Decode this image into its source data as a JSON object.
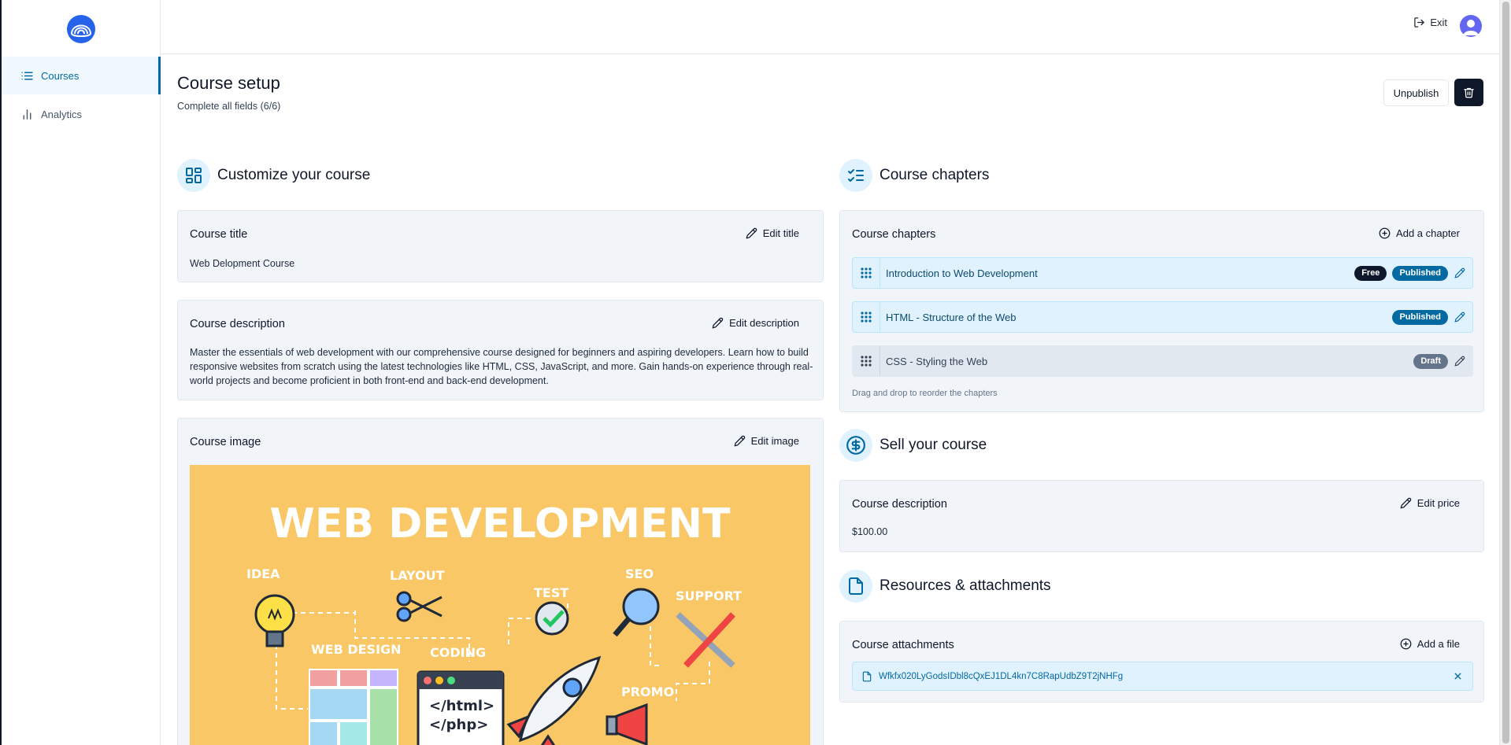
{
  "sidebar": {
    "items": [
      {
        "label": "Courses",
        "icon": "list-icon",
        "active": true
      },
      {
        "label": "Analytics",
        "icon": "bar-chart-icon",
        "active": false
      }
    ]
  },
  "topbar": {
    "exit_label": "Exit"
  },
  "header": {
    "title": "Course setup",
    "subtitle": "Complete all fields (6/6)",
    "unpublish_label": "Unpublish"
  },
  "customize": {
    "heading": "Customize your course",
    "title_card": {
      "label": "Course title",
      "action": "Edit title",
      "value": "Web Delopment Course"
    },
    "description_card": {
      "label": "Course description",
      "action": "Edit description",
      "value": "Master the essentials of web development with our comprehensive course designed for beginners and aspiring developers. Learn how to build responsive websites from scratch using the latest technologies like HTML, CSS, JavaScript, and more. Gain hands-on experience through real-world projects and become proficient in both front-end and back-end development."
    },
    "image_card": {
      "label": "Course image",
      "action": "Edit image",
      "image_text": {
        "headline": "WEB DEVELOPMENT",
        "idea": "IDEA",
        "layout": "LAYOUT",
        "test": "TEST",
        "seo": "SEO",
        "support": "SUPPORT",
        "web_design": "WEB DESIGN",
        "coding": "CODING",
        "promo": "PROMO",
        "code_line1": "</html>",
        "code_line2": "</php>"
      }
    }
  },
  "chapters": {
    "heading": "Course chapters",
    "card_label": "Course chapters",
    "action": "Add a chapter",
    "items": [
      {
        "title": "Introduction to Web Development",
        "free": "Free",
        "status": "Published"
      },
      {
        "title": "HTML - Structure of the Web",
        "status": "Published"
      },
      {
        "title": "CSS - Styling the Web",
        "status": "Draft"
      }
    ],
    "hint": "Drag and drop to reorder the chapters"
  },
  "sell": {
    "heading": "Sell your course",
    "card_label": "Course description",
    "action": "Edit price",
    "value": "$100.00"
  },
  "resources": {
    "heading": "Resources & attachments",
    "card_label": "Course attachments",
    "action": "Add a file",
    "files": [
      {
        "name": "Wfkfx020LyGodsIDbl8cQxEJ1DL4kn7C8RapUdbZ9T2jNHFg"
      }
    ]
  },
  "colors": {
    "accent": "#0369a1",
    "accent_light": "#e0f2fe",
    "card_bg": "#f1f5f9",
    "dark": "#0f172a",
    "image_bg": "#fac766"
  }
}
